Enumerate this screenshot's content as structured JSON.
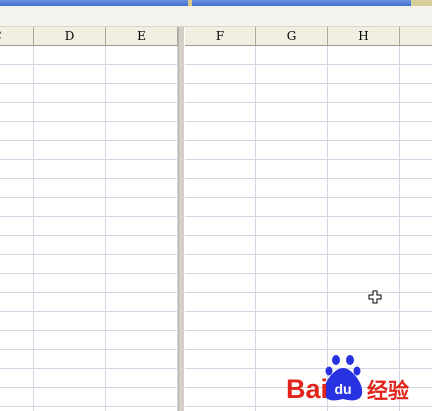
{
  "spreadsheet": {
    "left_pane": {
      "columns": [
        {
          "letter": "C"
        },
        {
          "letter": "D"
        },
        {
          "letter": "E"
        }
      ]
    },
    "right_pane": {
      "columns": [
        {
          "letter": "F"
        },
        {
          "letter": "G"
        },
        {
          "letter": "H"
        },
        {
          "letter": ""
        }
      ]
    },
    "visible_rows": 20
  },
  "cursor": {
    "icon": "cell-select-cross-cursor-icon"
  },
  "watermark": {
    "brand_latin": "Bai",
    "brand_paw_text": "du",
    "brand_cn": "经验",
    "colors": {
      "red": "#e1251b",
      "blue": "#2932e1"
    }
  },
  "colors": {
    "header_bg": "#f1efe2",
    "grid_line": "#d0d7e5",
    "split_bar": "#d4d0c8"
  }
}
